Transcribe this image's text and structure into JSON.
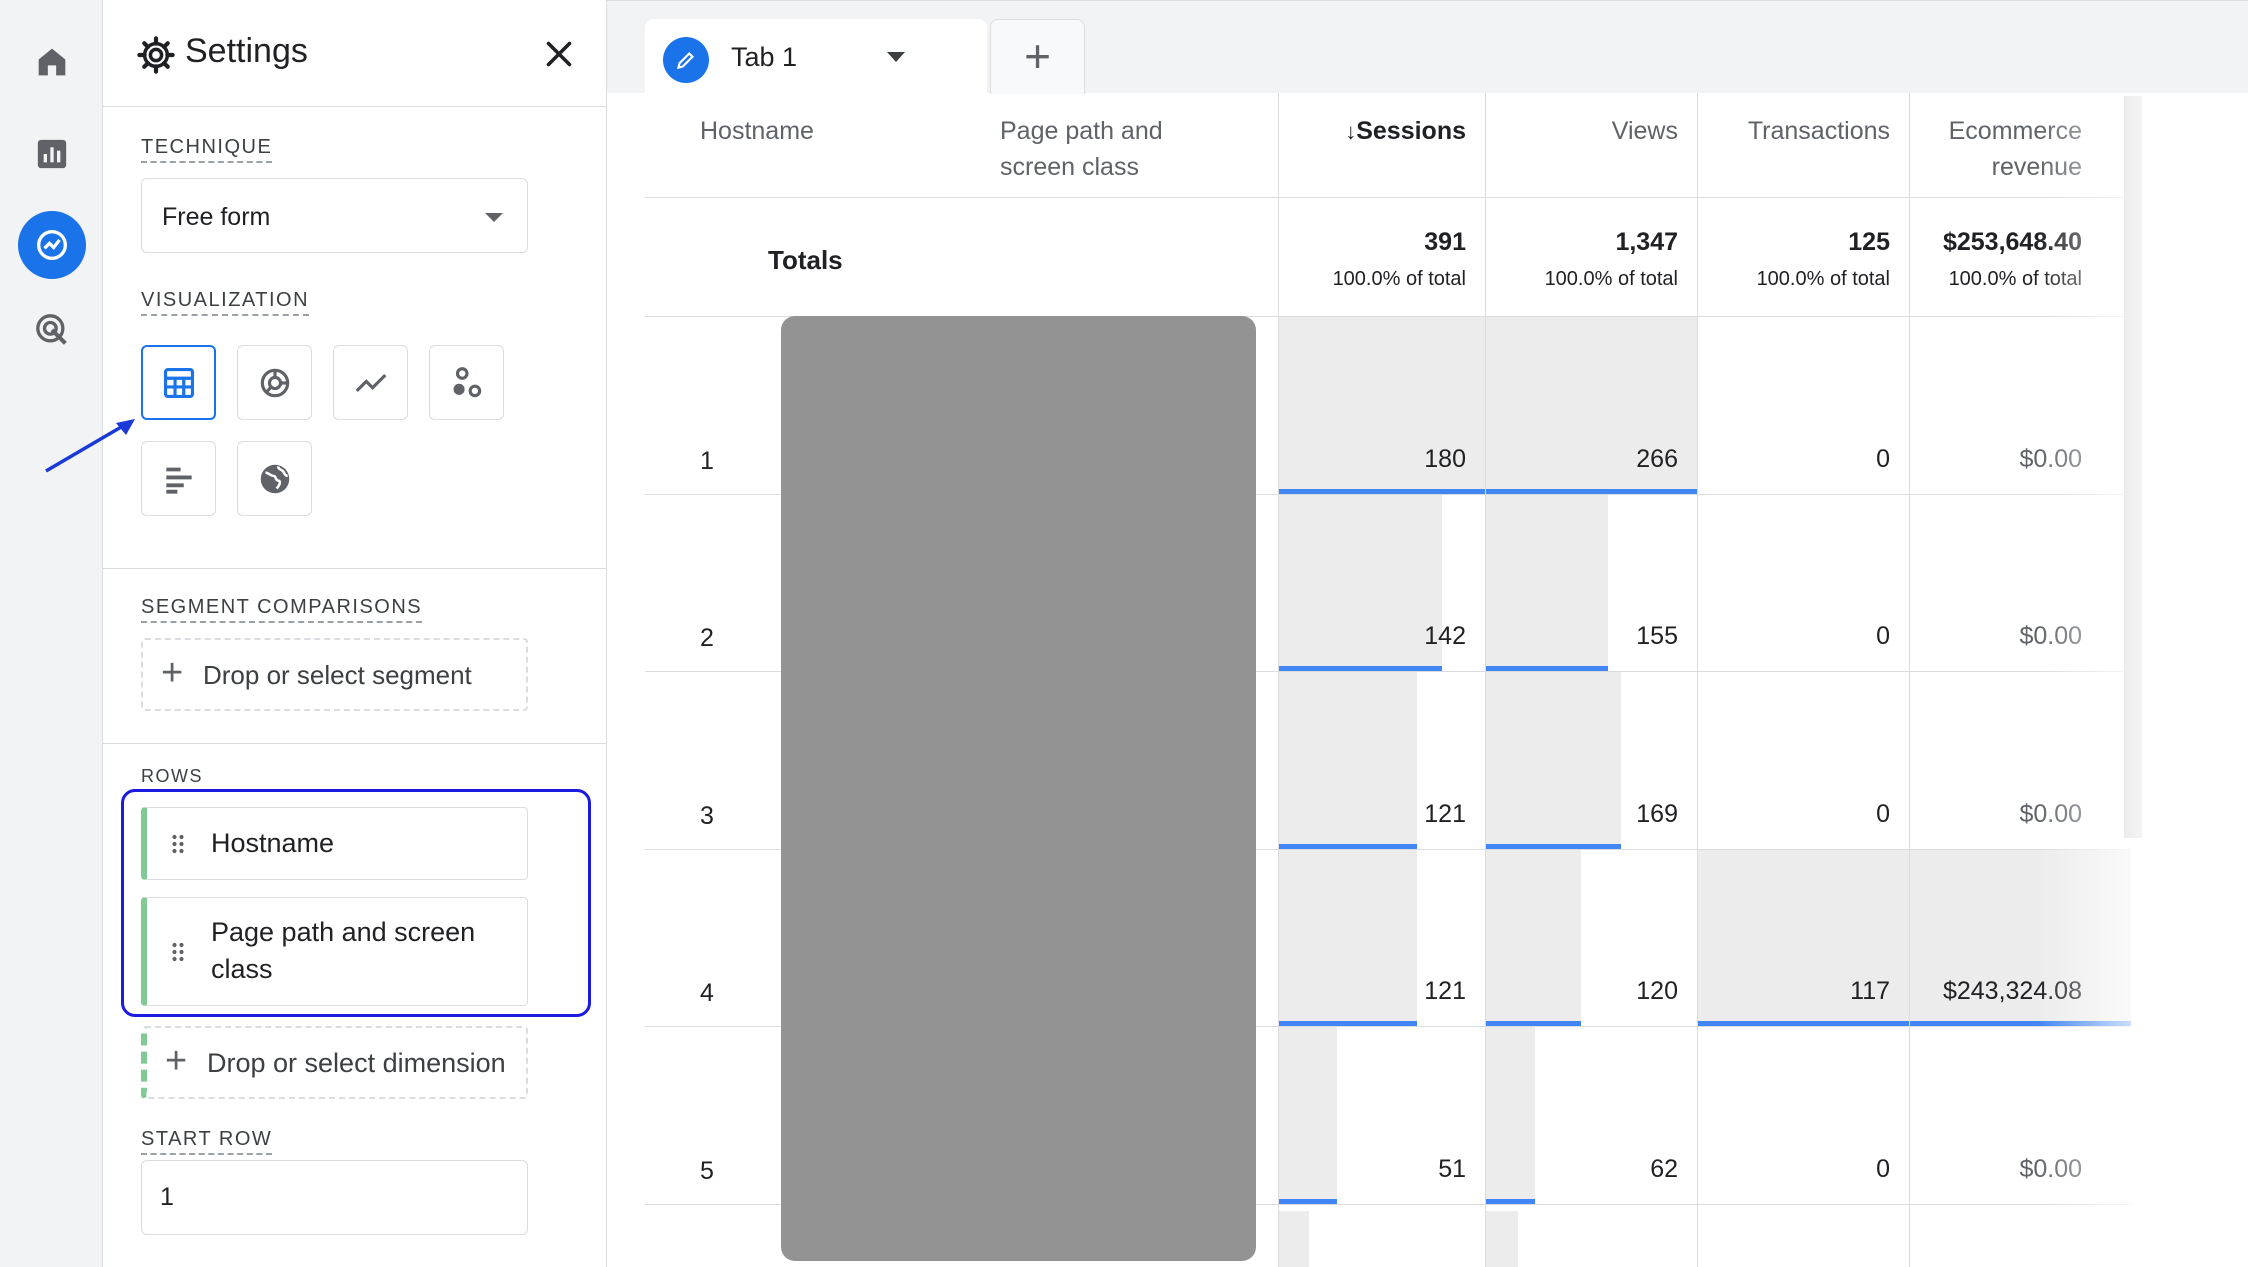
{
  "settings": {
    "title": "Settings",
    "technique_label": "TECHNIQUE",
    "technique_value": "Free form",
    "visualization_label": "VISUALIZATION",
    "segment_label": "SEGMENT COMPARISONS",
    "segment_placeholder": "Drop or select segment",
    "rows_label": "ROWS",
    "rows": [
      {
        "label": "Hostname"
      },
      {
        "label": "Page path and screen class"
      }
    ],
    "dimension_placeholder": "Drop or select dimension",
    "start_row_label": "START ROW",
    "start_row_value": "1"
  },
  "tabs": {
    "active_label": "Tab 1",
    "add_label": "+"
  },
  "table": {
    "headers": {
      "hostname": "Hostname",
      "page_path_line1": "Page path and",
      "page_path_line2": "screen class",
      "sessions": "Sessions",
      "sort_arrow": "↓",
      "views": "Views",
      "transactions": "Transactions",
      "revenue_line1": "Ecommerce",
      "revenue_line2": "revenue"
    },
    "totals": {
      "label": "Totals",
      "sessions": "391",
      "sessions_pct": "100.0% of total",
      "views": "1,347",
      "views_pct": "100.0% of total",
      "transactions": "125",
      "transactions_pct": "100.0% of total",
      "revenue": "$253,648.40",
      "revenue_pct": "100.0% of total"
    },
    "rows": [
      {
        "n": "1",
        "sessions": "180",
        "views": "266",
        "transactions": "0",
        "revenue": "$0.00",
        "sessions_frac": 1.0,
        "views_frac": 1.0,
        "transactions_frac": 0,
        "revenue_frac": 0
      },
      {
        "n": "2",
        "sessions": "142",
        "views": "155",
        "transactions": "0",
        "revenue": "$0.00",
        "sessions_frac": 0.79,
        "views_frac": 0.58,
        "transactions_frac": 0,
        "revenue_frac": 0
      },
      {
        "n": "3",
        "sessions": "121",
        "views": "169",
        "transactions": "0",
        "revenue": "$0.00",
        "sessions_frac": 0.67,
        "views_frac": 0.64,
        "transactions_frac": 0,
        "revenue_frac": 0
      },
      {
        "n": "4",
        "sessions": "121",
        "views": "120",
        "transactions": "117",
        "revenue": "$243,324.08",
        "sessions_frac": 0.67,
        "views_frac": 0.45,
        "transactions_frac": 1.0,
        "revenue_frac": 1.0
      },
      {
        "n": "5",
        "sessions": "51",
        "views": "62",
        "transactions": "0",
        "revenue": "$0.00",
        "sessions_frac": 0.28,
        "views_frac": 0.23,
        "transactions_frac": 0,
        "revenue_frac": 0
      }
    ]
  },
  "colors": {
    "accent": "#1a73e8",
    "bar": "#4285f4",
    "chip_accent": "#81c995",
    "highlight_box": "#1a1ae0"
  },
  "icons": [
    "home-icon",
    "reports-icon",
    "explore-icon",
    "advertising-icon",
    "gear-icon",
    "close-icon",
    "table-icon",
    "donut-chart-icon",
    "line-chart-icon",
    "scatter-icon",
    "bar-chart-icon",
    "geo-map-icon",
    "drag-handle-icon",
    "pencil-icon",
    "plus-icon"
  ]
}
